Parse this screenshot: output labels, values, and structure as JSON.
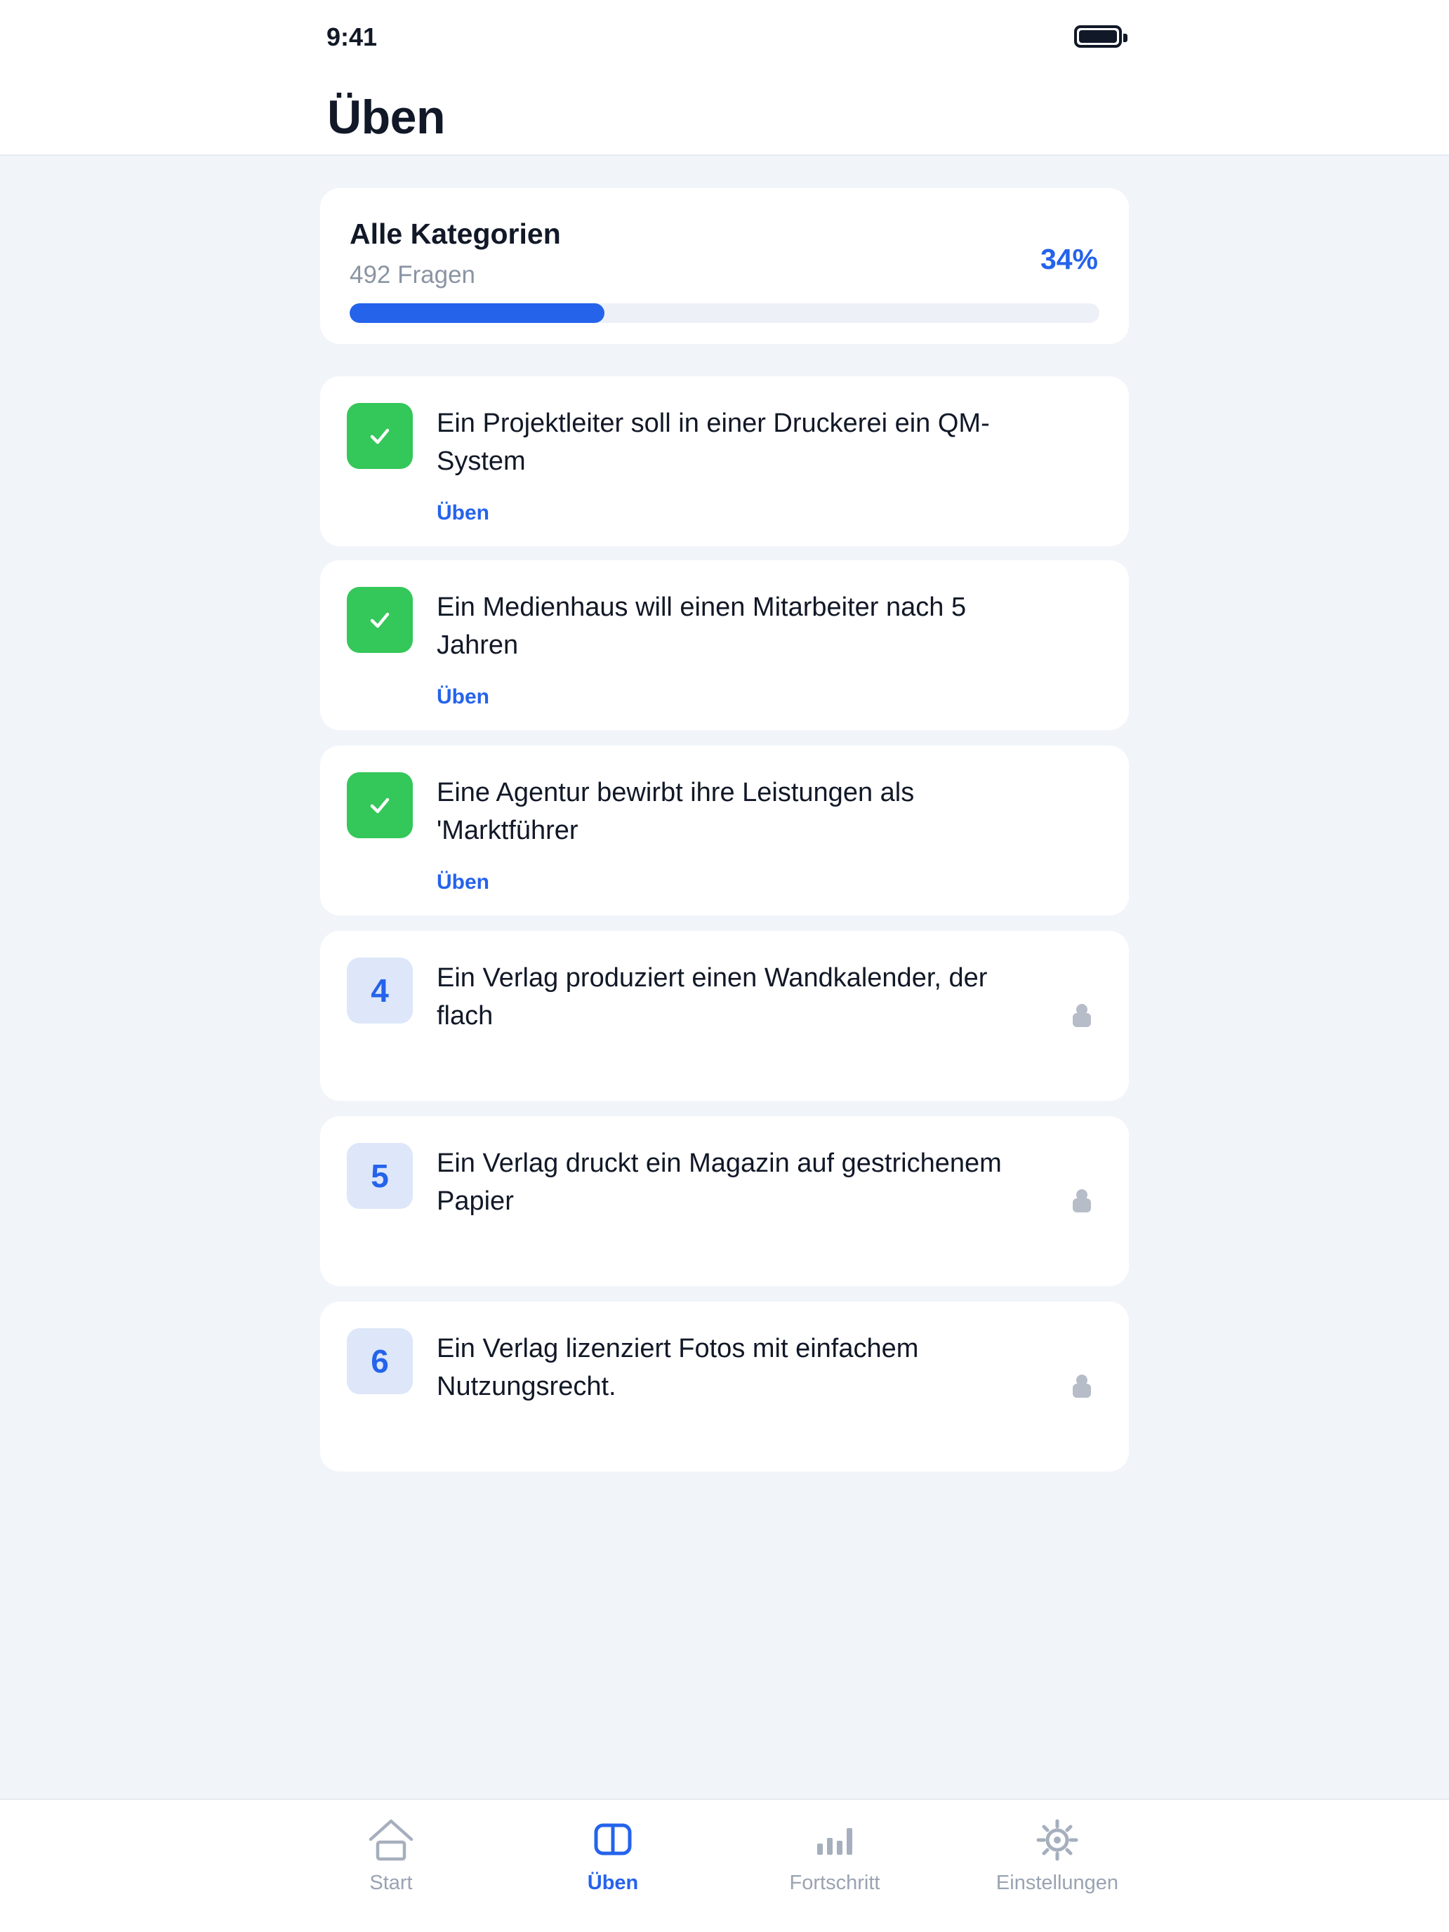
{
  "status_bar": {
    "time": "9:41"
  },
  "page": {
    "title": "Üben"
  },
  "summary": {
    "title": "Alle Kategorien",
    "subtitle": "492 Fragen",
    "percent_label": "34%",
    "progress": 0.34
  },
  "items": [
    {
      "status": "done",
      "badge": "",
      "text": "Ein Projektleiter soll in einer Druckerei ein QM-System",
      "action": "Üben"
    },
    {
      "status": "done",
      "badge": "",
      "text": "Ein Medienhaus will einen Mitarbeiter nach 5 Jahren",
      "action": "Üben"
    },
    {
      "status": "done",
      "badge": "",
      "text": "Eine Agentur bewirbt ihre Leistungen als 'Marktführer",
      "action": "Üben"
    },
    {
      "status": "locked",
      "badge": "4",
      "text": "Ein Verlag produziert einen Wandkalender, der flach",
      "action": ""
    },
    {
      "status": "locked",
      "badge": "5",
      "text": "Ein Verlag druckt ein Magazin auf gestrichenem Papier",
      "action": ""
    },
    {
      "status": "locked",
      "badge": "6",
      "text": "Ein Verlag lizenziert Fotos mit einfachem Nutzungsrecht.",
      "action": ""
    }
  ],
  "tabs": [
    {
      "label": "Start",
      "icon": "home-icon",
      "active": false
    },
    {
      "label": "Üben",
      "icon": "book-icon",
      "active": true
    },
    {
      "label": "Fortschritt",
      "icon": "bar-chart-icon",
      "active": false
    },
    {
      "label": "Einstellungen",
      "icon": "gear-icon",
      "active": false
    }
  ],
  "colors": {
    "accent": "#2563eb",
    "success": "#34c759",
    "background": "#f1f5fa",
    "muted": "#9aa3b2"
  }
}
